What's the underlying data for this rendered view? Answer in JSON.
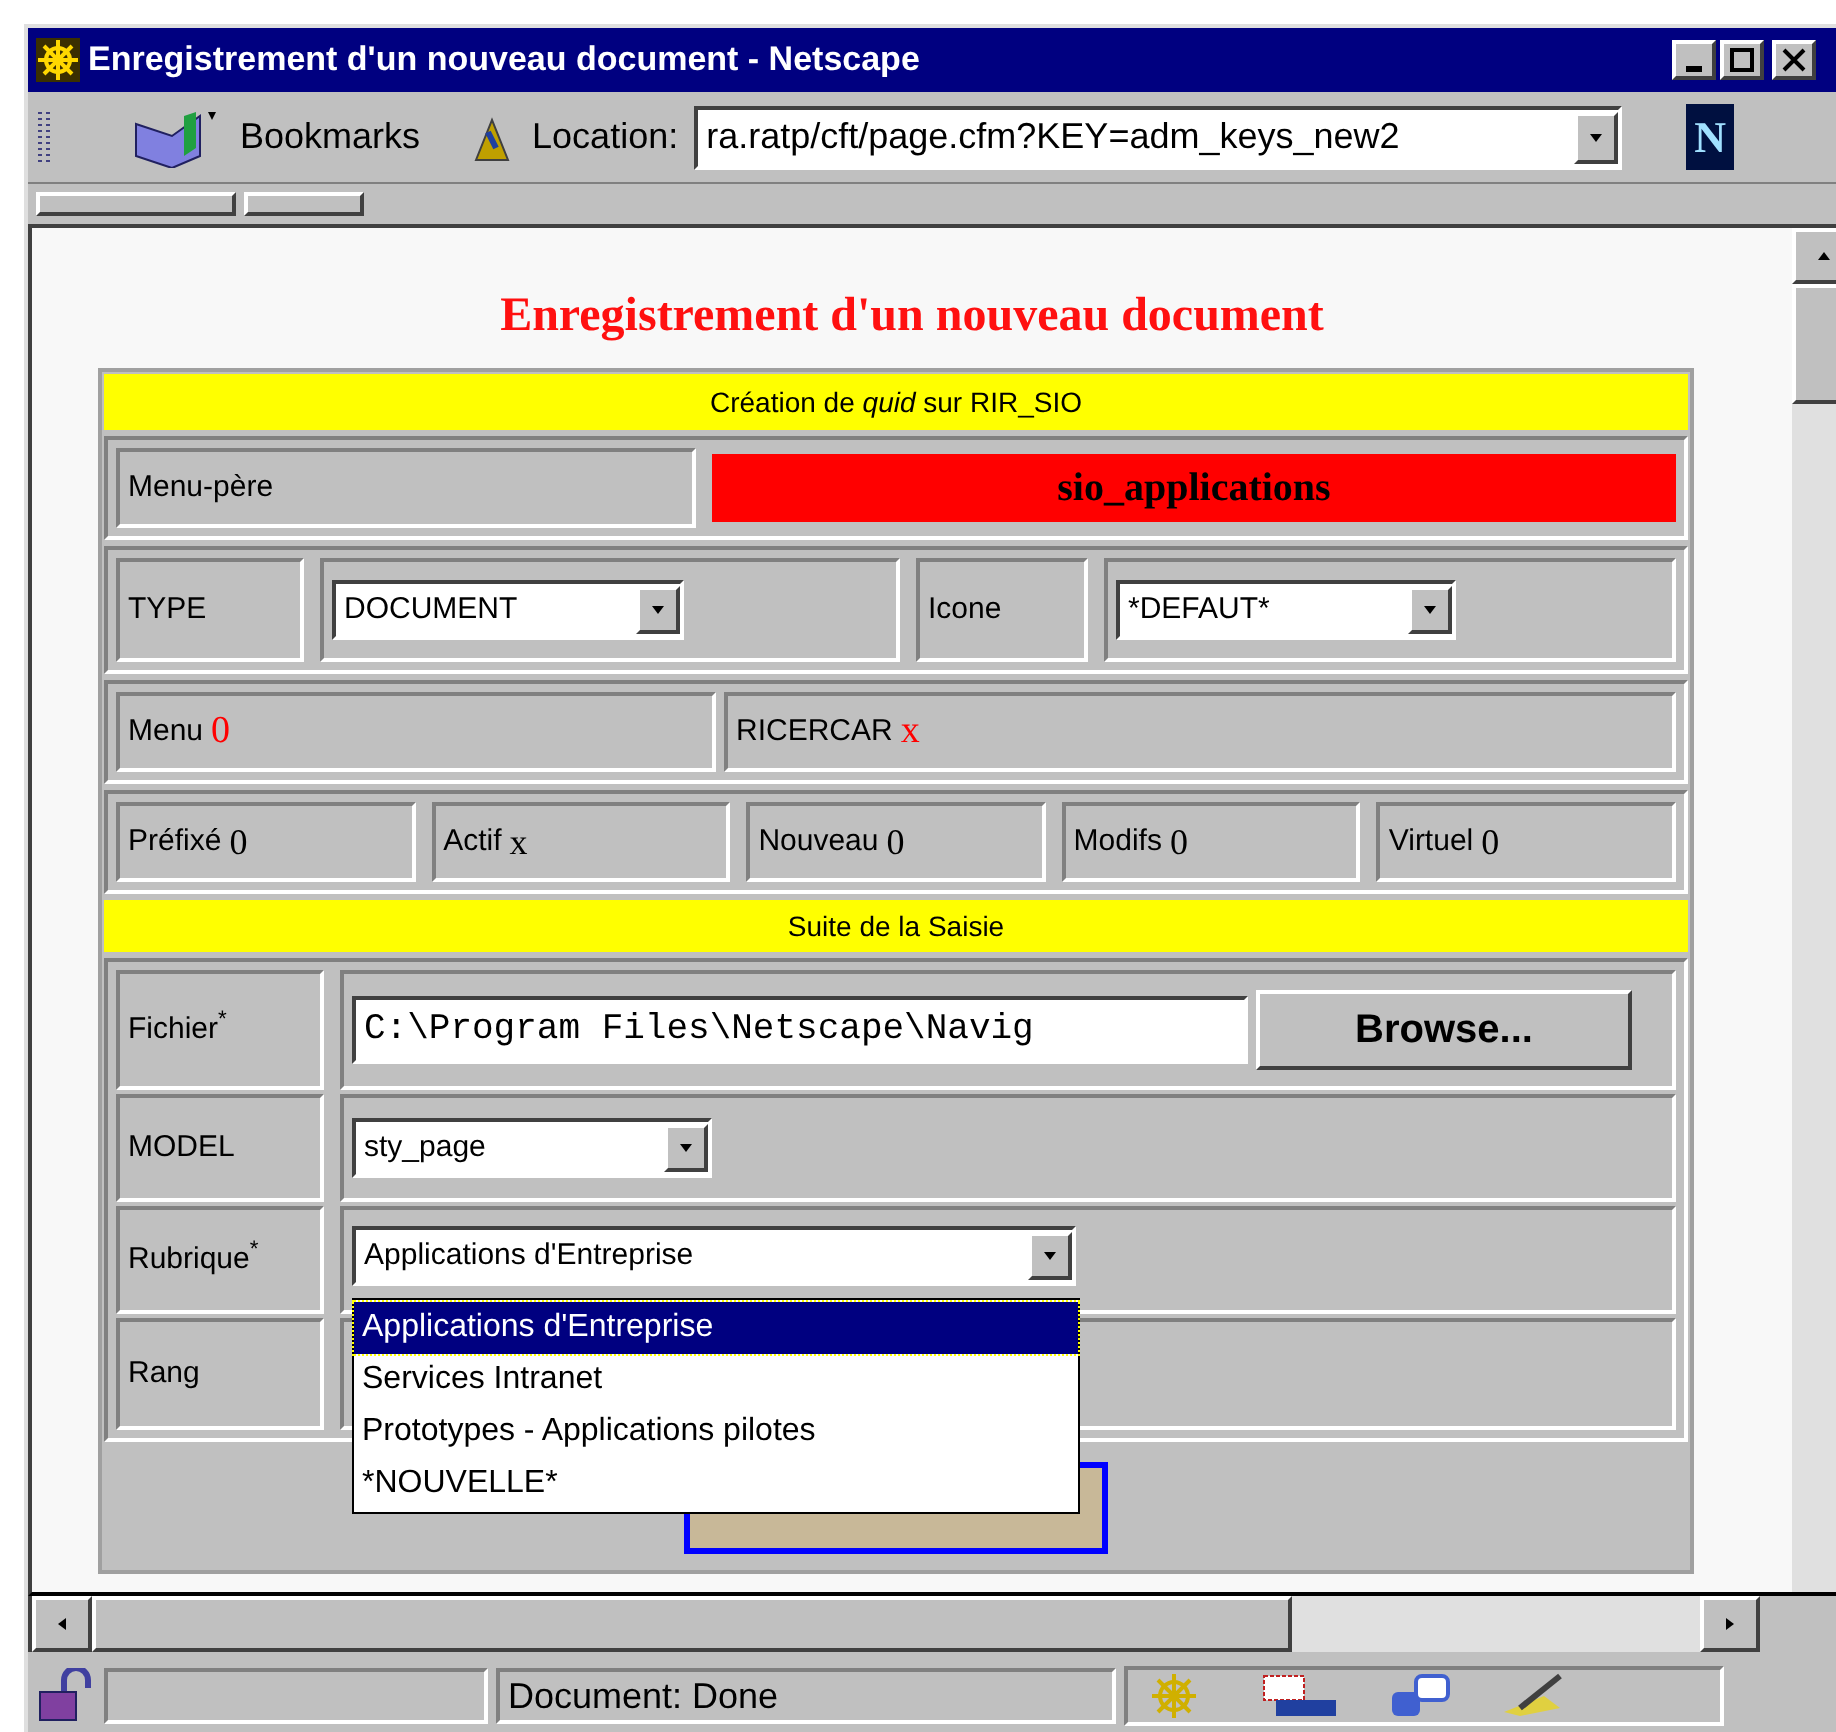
{
  "window": {
    "title": "Enregistrement d'un nouveau document - Netscape"
  },
  "toolbar": {
    "bookmarks": "Bookmarks",
    "location_label": "Location:",
    "location_value": "ra.ratp/cft/page.cfm?KEY=adm_keys_new2",
    "logo_letter": "N"
  },
  "page": {
    "heading": "Enregistrement d'un nouveau document",
    "section_1": "Création de *quid* sur RIR_SIO",
    "menu_pere": {
      "label": "Menu-père",
      "value": "sio_applications"
    },
    "type": {
      "label": "TYPE",
      "value": "DOCUMENT"
    },
    "icone": {
      "label": "Icone",
      "value": "*DEFAUT*"
    },
    "info": [
      {
        "label": "Menu",
        "value": "0",
        "color": "#ff0000"
      },
      {
        "label": "RICERCAR",
        "value": "x",
        "color": "#ff0000"
      }
    ],
    "flags": [
      {
        "label": "Préfixé",
        "value": "0"
      },
      {
        "label": "Actif",
        "value": "x"
      },
      {
        "label": "Nouveau",
        "value": "0"
      },
      {
        "label": "Modifs",
        "value": "0"
      },
      {
        "label": "Virtuel",
        "value": "0"
      }
    ],
    "section_2": "Suite de la Saisie",
    "fichier": {
      "label": "Fichier",
      "mark": "*",
      "value": "C:\\Program Files\\Netscape\\Navig",
      "button": "Browse..."
    },
    "model": {
      "label": "MODEL",
      "value": "sty_page"
    },
    "rubrique": {
      "label": "Rubrique",
      "mark": "*",
      "value": "Applications d'Entreprise",
      "expanded": true,
      "options": [
        {
          "label": "Applications d'Entreprise",
          "selected": true
        },
        {
          "label": "Services Intranet",
          "selected": false
        },
        {
          "label": "Prototypes - Applications pilotes",
          "selected": false
        },
        {
          "label": "*NOUVELLE*",
          "selected": false
        }
      ]
    },
    "rang": {
      "label": "Rang"
    }
  },
  "status_bar": {
    "text": "Document: Done"
  }
}
